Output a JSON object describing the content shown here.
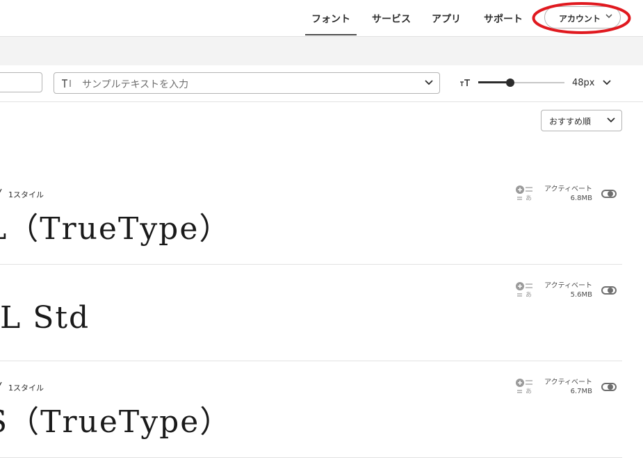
{
  "nav": {
    "items": [
      {
        "label": "フォント",
        "active": true
      },
      {
        "label": "サービス",
        "active": false
      },
      {
        "label": "アプリ",
        "active": false
      },
      {
        "label": "サポート",
        "active": false
      }
    ],
    "account_label": "アカウント",
    "highlight_color": "#e0191f"
  },
  "toolbar": {
    "sample_placeholder": "サンプルテキストを入力",
    "size_value": "48px",
    "slider_level": 0.37
  },
  "sort": {
    "label": "おすすめ順"
  },
  "fonts": [
    {
      "styles": "1スタイル",
      "preview": "L（TrueType）",
      "activate_label": "アクティベート",
      "size": "6.8MB",
      "icons": {
        "check": "check-icon",
        "add": "add-to-list-icon"
      }
    },
    {
      "styles": "",
      "preview": "L Std",
      "activate_label": "アクティベート",
      "size": "5.6MB",
      "icons": {
        "add": "add-to-list-icon"
      }
    },
    {
      "styles": "1スタイル",
      "preview": "S（TrueType）",
      "activate_label": "アクティベート",
      "size": "6.7MB",
      "icons": {
        "check": "check-icon",
        "add": "add-to-list-icon"
      }
    }
  ]
}
